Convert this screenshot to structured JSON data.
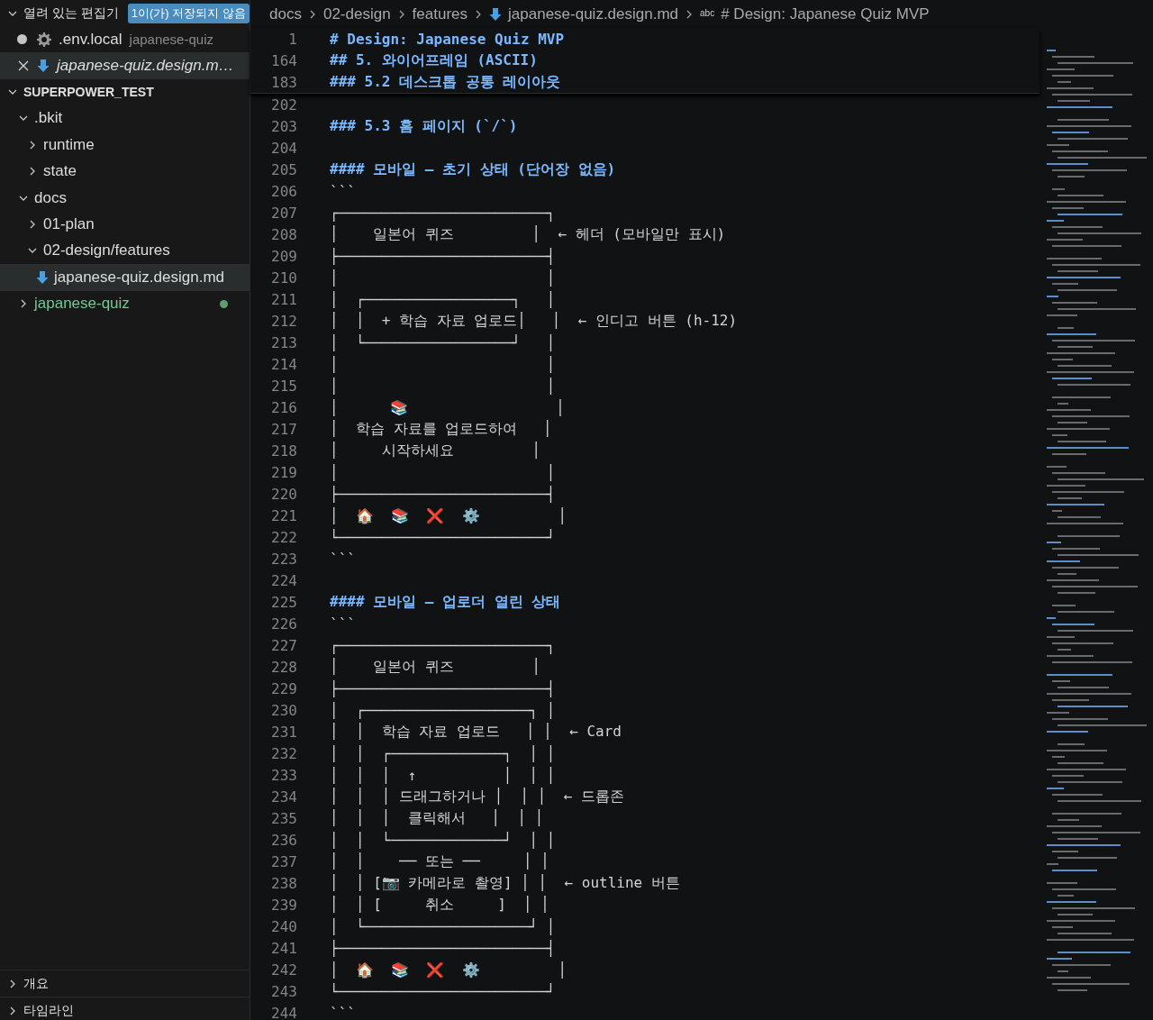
{
  "sidebar": {
    "open_editors": {
      "title": "열려 있는 편집기",
      "badge": "1이(가) 저장되지 않음",
      "expanded": true,
      "items": [
        {
          "name": ".env.local",
          "description": "japanese-quiz",
          "kind": "settings",
          "dirty": true,
          "preview": false,
          "selected": false
        },
        {
          "name": "japanese-quiz.design.m…",
          "kind": "markdown",
          "dirty": false,
          "preview": true,
          "selected": true
        }
      ]
    },
    "explorer": {
      "title": "SUPERPOWER_TEST",
      "expanded": true,
      "tree": [
        {
          "labels": [
            ".bkit"
          ],
          "kind": "folder",
          "expanded": true,
          "selected": false,
          "untracked": false,
          "children": [
            {
              "labels": [
                "runtime"
              ],
              "kind": "folder",
              "expanded": false,
              "selected": false,
              "untracked": false
            },
            {
              "labels": [
                "state"
              ],
              "kind": "folder",
              "expanded": false,
              "selected": false,
              "untracked": false
            }
          ]
        },
        {
          "labels": [
            "docs"
          ],
          "kind": "folder",
          "expanded": true,
          "selected": false,
          "untracked": false,
          "children": [
            {
              "labels": [
                "01-plan"
              ],
              "kind": "folder",
              "expanded": false,
              "selected": false,
              "untracked": false
            },
            {
              "labels": [
                "02-design/features"
              ],
              "kind": "folder",
              "expanded": true,
              "selected": false,
              "untracked": false,
              "children": [
                {
                  "labels": [
                    "japanese-quiz.design.md"
                  ],
                  "kind": "markdown",
                  "selected": true,
                  "untracked": false
                }
              ]
            }
          ]
        },
        {
          "labels": [
            "japanese-quiz"
          ],
          "kind": "folder",
          "expanded": false,
          "selected": false,
          "untracked": true
        }
      ]
    },
    "bottom_sections": [
      {
        "title": "개요",
        "expanded": false
      },
      {
        "title": "타임라인",
        "expanded": false
      }
    ]
  },
  "breadcrumb": [
    {
      "label": "docs",
      "kind": "folder"
    },
    {
      "label": "02-design",
      "kind": "folder"
    },
    {
      "label": "features",
      "kind": "folder"
    },
    {
      "label": "japanese-quiz.design.md",
      "kind": "markdown"
    },
    {
      "label": "# Design: Japanese Quiz MVP",
      "kind": "symbol",
      "glyph": "abc"
    }
  ],
  "sticky_lines": [
    {
      "n": "1",
      "text": "# Design: Japanese Quiz MVP",
      "kind": "heading"
    },
    {
      "n": "164",
      "text": "## 5. 와이어프레임 (ASCII)",
      "kind": "heading"
    },
    {
      "n": "183",
      "text": "### 5.2 데스크톱 공통 레이아웃",
      "kind": "heading"
    }
  ],
  "lines": [
    {
      "n": "202"
    },
    {
      "n": "203",
      "text": "### 5.3 홈 페이지 (`/`)",
      "kind": "heading"
    },
    {
      "n": "204"
    },
    {
      "n": "205",
      "text": "#### 모바일 — 초기 상태 (단어장 없음)",
      "kind": "heading"
    },
    {
      "n": "206",
      "text": "```",
      "kind": "code"
    },
    {
      "n": "207",
      "text": "┌────────────────────────┐",
      "kind": "code"
    },
    {
      "n": "208",
      "text": "│    일본어 퀴즈         │  ← 헤더 (모바일만 표시)",
      "kind": "code"
    },
    {
      "n": "209",
      "text": "├────────────────────────┤",
      "kind": "code"
    },
    {
      "n": "210",
      "text": "│                        │",
      "kind": "code"
    },
    {
      "n": "211",
      "text": "│  ┌─────────────────┐   │",
      "kind": "code"
    },
    {
      "n": "212",
      "text": "│  │  + 학습 자료 업로드│   │  ← 인디고 버튼 (h-12)",
      "kind": "code"
    },
    {
      "n": "213",
      "text": "│  └─────────────────┘   │",
      "kind": "code"
    },
    {
      "n": "214",
      "text": "│                        │",
      "kind": "code"
    },
    {
      "n": "215",
      "text": "│                        │",
      "kind": "code"
    },
    {
      "n": "216",
      "text": "│      📚                 │",
      "kind": "code"
    },
    {
      "n": "217",
      "text": "│  학습 자료를 업로드하여   │",
      "kind": "code"
    },
    {
      "n": "218",
      "text": "│     시작하세요         │",
      "kind": "code"
    },
    {
      "n": "219",
      "text": "│                        │",
      "kind": "code"
    },
    {
      "n": "220",
      "text": "├────────────────────────┤",
      "kind": "code"
    },
    {
      "n": "221",
      "text": "│  🏠  📚  ❌  ⚙️         │",
      "kind": "code"
    },
    {
      "n": "222",
      "text": "└────────────────────────┘",
      "kind": "code"
    },
    {
      "n": "223",
      "text": "```",
      "kind": "code"
    },
    {
      "n": "224"
    },
    {
      "n": "225",
      "text": "#### 모바일 — 업로더 열린 상태",
      "kind": "heading"
    },
    {
      "n": "226",
      "text": "```",
      "kind": "code"
    },
    {
      "n": "227",
      "text": "┌────────────────────────┐",
      "kind": "code"
    },
    {
      "n": "228",
      "text": "│    일본어 퀴즈         │",
      "kind": "code"
    },
    {
      "n": "229",
      "text": "├────────────────────────┤",
      "kind": "code"
    },
    {
      "n": "230",
      "text": "│  ┌───────────────────┐ │",
      "kind": "code"
    },
    {
      "n": "231",
      "text": "│  │  학습 자료 업로드   │ │  ← Card",
      "kind": "code"
    },
    {
      "n": "232",
      "text": "│  │  ┌─────────────┐  │ │",
      "kind": "code"
    },
    {
      "n": "233",
      "text": "│  │  │  ↑          │  │ │",
      "kind": "code"
    },
    {
      "n": "234",
      "text": "│  │  │ 드래그하거나 │  │ │  ← 드롭존",
      "kind": "code"
    },
    {
      "n": "235",
      "text": "│  │  │  클릭해서   │  │ │",
      "kind": "code"
    },
    {
      "n": "236",
      "text": "│  │  └─────────────┘  │ │",
      "kind": "code"
    },
    {
      "n": "237",
      "text": "│  │    ── 또는 ──     │ │",
      "kind": "code"
    },
    {
      "n": "238",
      "text": "│  │ [📷 카메라로 촬영] │ │  ← outline 버튼",
      "kind": "code"
    },
    {
      "n": "239",
      "text": "│  │ [     취소     ]  │ │",
      "kind": "code"
    },
    {
      "n": "240",
      "text": "│  └───────────────────┘ │",
      "kind": "code"
    },
    {
      "n": "241",
      "text": "├────────────────────────┤",
      "kind": "code"
    },
    {
      "n": "242",
      "text": "│  🏠  📚  ❌  ⚙️         │",
      "kind": "code"
    },
    {
      "n": "243",
      "text": "└────────────────────────┘",
      "kind": "code"
    },
    {
      "n": "244",
      "text": "```",
      "kind": "code"
    }
  ]
}
